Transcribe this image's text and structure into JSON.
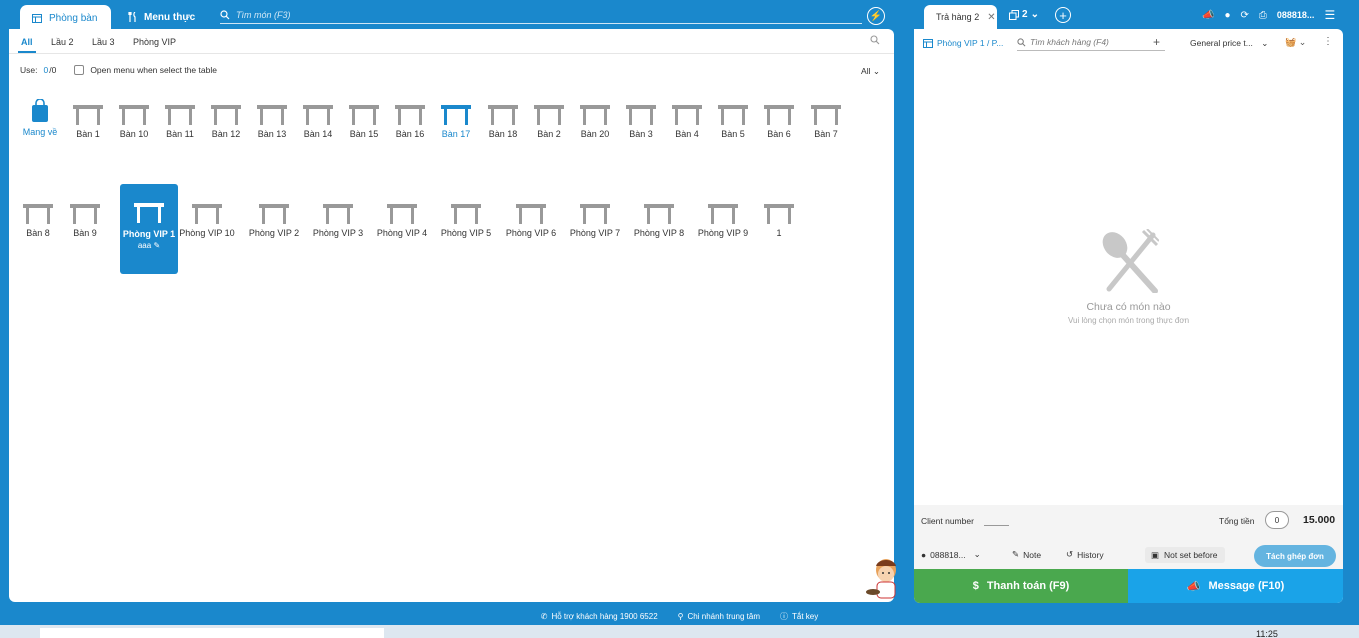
{
  "topbar": {
    "tab_rooms": "Phòng bàn",
    "tab_menu": "Menu thực",
    "search_placeholder": "Tìm món (F3)"
  },
  "filters": {
    "items": [
      "All",
      "Lầu 2",
      "Lầu 3",
      "Phòng VIP"
    ],
    "use_label": "Use:",
    "use_value": "0",
    "use_total": "/0",
    "open_menu_label": "Open menu when select the table",
    "all_dropdown": "All"
  },
  "tables_row1": [
    "Mang về",
    "Bàn 1",
    "Bàn 10",
    "Bàn 11",
    "Bàn 12",
    "Bàn 13",
    "Bàn 14",
    "Bàn 15",
    "Bàn 16",
    "Bàn 17",
    "Bàn 18",
    "Bàn 2",
    "Bàn 20",
    "Bàn 3",
    "Bàn 4",
    "Bàn 5",
    "Bàn 6",
    "Bàn 7"
  ],
  "tables_row2": [
    "Bàn 8",
    "Bàn 9",
    "Phòng VIP 1",
    "Phòng VIP 10",
    "Phòng VIP 2",
    "Phòng VIP 3",
    "Phòng VIP 4",
    "Phòng VIP 5",
    "Phòng VIP 6",
    "Phòng VIP 7",
    "Phòng VIP 8",
    "Phòng VIP 9",
    "1"
  ],
  "selected_sub": "ааа",
  "colors": {
    "accent": "#1a88cc",
    "pay": "#4aa84e",
    "message": "#1aa3e8"
  },
  "order": {
    "tab_label": "Trả hàng 2",
    "copy_count": "2",
    "phone_short": "088818...",
    "room": "Phòng VIP 1 / P...",
    "customer_placeholder": "Tìm khách hàng (F4)",
    "price_list": "General price t...",
    "empty_title": "Chưa có món nào",
    "empty_sub": "Vui lòng chọn món trong thực đơn",
    "client_number_label": "Client number",
    "total_label": "Tổng tiền",
    "qty": "0",
    "total": "15.000",
    "customer_phone": "088818...",
    "note": "Note",
    "history": "History",
    "not_set": "Not set before",
    "split_merge": "Tách ghép đơn",
    "pay": "Thanh toán (F9)",
    "message": "Message (F10)"
  },
  "status": {
    "support": "Hỗ trợ khách hàng 1900 6522",
    "branch": "Chi nhánh trung tâm",
    "shortcut": "Tắt key"
  },
  "taskbar_clock": "11:25"
}
